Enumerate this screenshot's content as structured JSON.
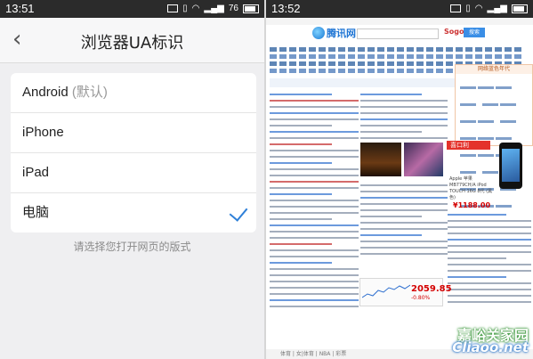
{
  "left_screen": {
    "status_bar": {
      "time": "13:51",
      "battery": "76"
    },
    "header": {
      "back_icon": "chevron-left-icon",
      "title": "浏览器UA标识"
    },
    "options": [
      {
        "label": "Android",
        "hint": "(默认)",
        "selected": false
      },
      {
        "label": "iPhone",
        "hint": "",
        "selected": false
      },
      {
        "label": "iPad",
        "hint": "",
        "selected": false
      },
      {
        "label": "电脑",
        "hint": "",
        "selected": true
      }
    ],
    "footer_note": "请选择您打开网页的版式",
    "accent_color": "#2f80d8"
  },
  "right_screen": {
    "status_bar": {
      "time": "13:52"
    },
    "site": {
      "logo_text": "腾讯网",
      "search_button": "搜索",
      "search_brand": "Sogou",
      "event_box_title": "网络蓝色年代",
      "side_label": "喜口利",
      "ad_text": "Apple 苹果 MB779CH/A iPod TOUCH 16G 8代 (黑色)",
      "price": "¥1188.00",
      "stock_value": "2059.85",
      "stock_change": "-0.80%",
      "footer_links": "体育 | 女|体育 | NBA | 彩票"
    },
    "watermark": {
      "line1": "嘉峪关家园",
      "line2": "Cliaoo.net"
    }
  }
}
